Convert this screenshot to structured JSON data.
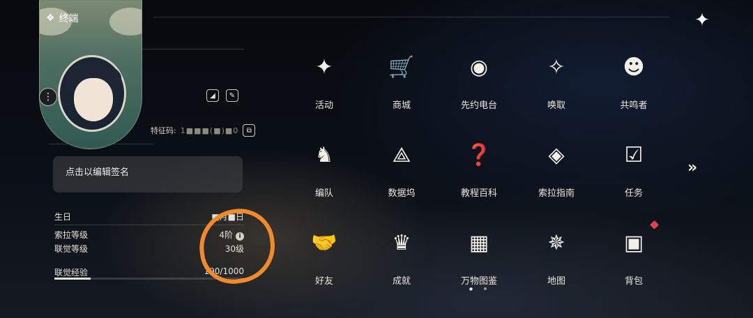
{
  "header": {
    "terminal_label": "终端",
    "close_icon": "sparkle-close-icon"
  },
  "profile": {
    "id_label": "特征码:",
    "id_value": "1■■■(■)■0",
    "signature_placeholder": "点击以编辑签名",
    "stats": [
      {
        "label": "生日",
        "value": "■月■日"
      },
      {
        "label": "索拉等级",
        "value": "4阶"
      },
      {
        "label": "联觉等级",
        "value": "30级"
      },
      {
        "label": "联觉经验",
        "value": "190/1000"
      }
    ],
    "exp_fraction": 0.19
  },
  "menu": {
    "items": [
      {
        "label": "活动",
        "icon": "activity-icon",
        "glyph": "✦"
      },
      {
        "label": "商城",
        "icon": "shop-cart-icon",
        "glyph": "🛒"
      },
      {
        "label": "先约电台",
        "icon": "radio-icon",
        "glyph": "◉"
      },
      {
        "label": "唤取",
        "icon": "summon-compass-icon",
        "glyph": "✧"
      },
      {
        "label": "共鸣者",
        "icon": "resonator-icon",
        "glyph": "☻"
      },
      {
        "label": "编队",
        "icon": "team-icon",
        "glyph": "♞"
      },
      {
        "label": "数据坞",
        "icon": "data-dock-icon",
        "glyph": "⟁"
      },
      {
        "label": "教程百科",
        "icon": "tutorial-book-icon",
        "glyph": "❓"
      },
      {
        "label": "索拉指南",
        "icon": "guide-book-icon",
        "glyph": "◈"
      },
      {
        "label": "任务",
        "icon": "quest-icon",
        "glyph": "☑"
      },
      {
        "label": "好友",
        "icon": "handshake-icon",
        "glyph": "🤝"
      },
      {
        "label": "成就",
        "icon": "trophy-icon",
        "glyph": "♛"
      },
      {
        "label": "万物图鉴",
        "icon": "cards-icon",
        "glyph": "▦"
      },
      {
        "label": "地图",
        "icon": "map-compass-icon",
        "glyph": "✵"
      },
      {
        "label": "背包",
        "icon": "backpack-icon",
        "glyph": "▣"
      }
    ],
    "next_page_icon": "double-chevron-right-icon"
  },
  "colors": {
    "highlight_circle": "#f08a2a",
    "notification": "#e0424f"
  }
}
